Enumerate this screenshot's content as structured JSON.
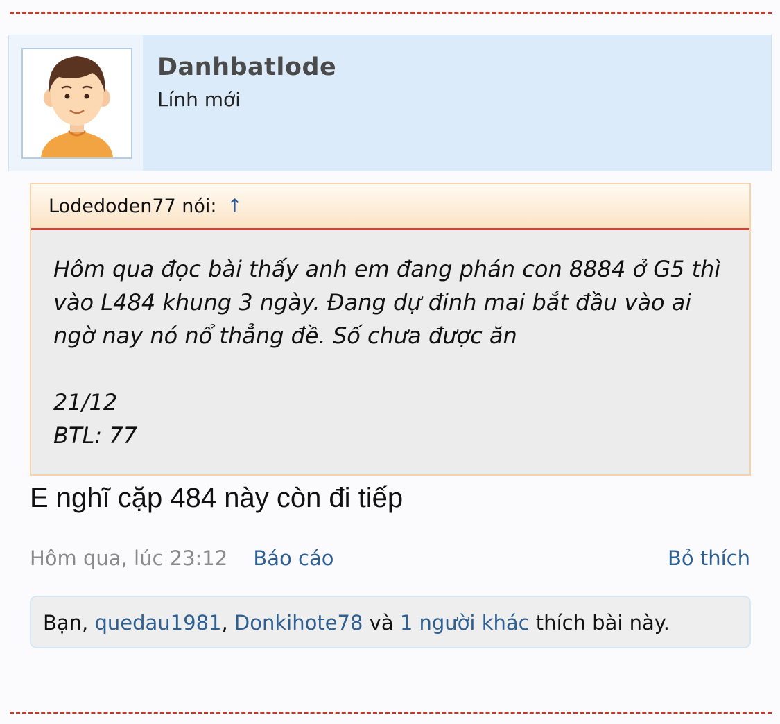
{
  "user": {
    "name": "Danhbatlode",
    "rank": "Lính mới",
    "avatar_icon": "default-male-avatar-icon"
  },
  "quote": {
    "author": "Lodedoden77 nói:",
    "arrow": "↑",
    "lines": [
      "Hôm qua đọc bài thấy anh em đang phán con 8884 ở G5 thì",
      "vào L484 khung 3 ngày. Đang dự đinh mai bắt đầu vào ai",
      "ngờ nay nó nổ thẳng đề. Số chưa được ăn"
    ],
    "date_line": "21/12",
    "btl_line": "BTL: 77"
  },
  "post": {
    "text": "E nghĩ cặp 484 này còn đi tiếp",
    "timestamp": "Hôm qua, lúc 23:12",
    "report_label": "Báo cáo",
    "unlike_label": "Bỏ thích"
  },
  "likes": {
    "prefix": "Bạn, ",
    "user1": "quedau1981",
    "sep": ", ",
    "user2": "Donkihote78",
    "and": " và ",
    "others": "1 người khác",
    "suffix": " thích bài này."
  },
  "colors": {
    "link": "#2e5f93",
    "divider": "#c0392b",
    "header_bg": "#dcebf9"
  }
}
